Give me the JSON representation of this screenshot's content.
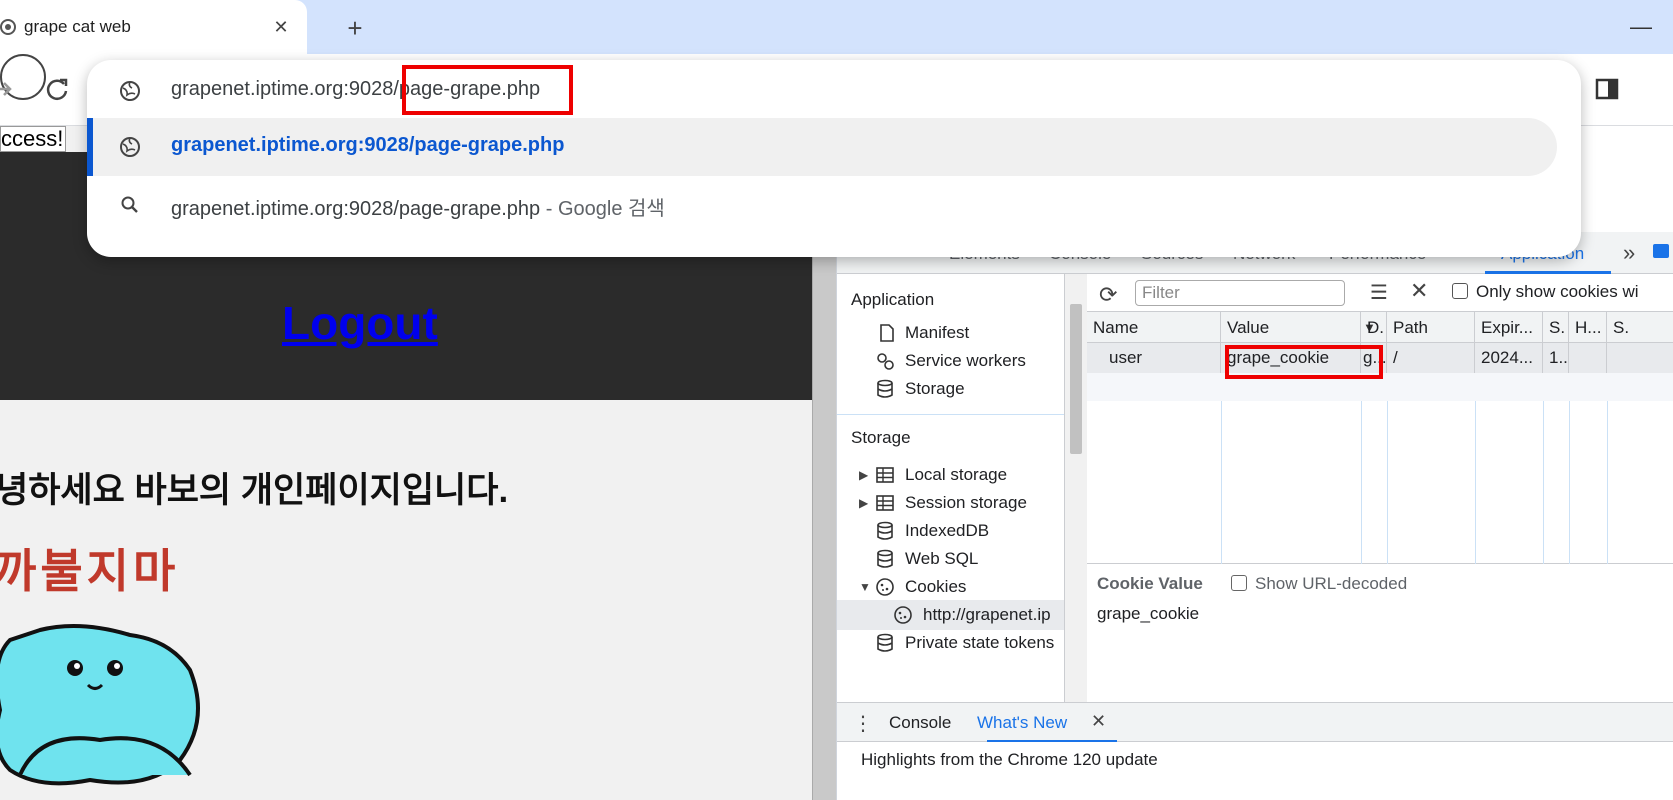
{
  "browser": {
    "tab_title": "grape cat web",
    "tab_close": "✕",
    "new_tab": "+",
    "minimize": "—"
  },
  "omnibox": {
    "input_host": "grapenet.iptime.org:9028",
    "input_path": "/page-grape.php",
    "suggestion_url": "grapenet.iptime.org:9028/page-grape.php",
    "search_query": "grapenet.iptime.org:9028/page-grape.php",
    "search_suffix": " - Google 검색"
  },
  "page": {
    "success_text": "ccess!",
    "logout_label": "Logout",
    "greeting": "녕하세요 바보의 개인페이지입니다.",
    "doodle_text": "까불지마"
  },
  "devtools": {
    "tabs": [
      {
        "label": "Elements"
      },
      {
        "label": "Console"
      },
      {
        "label": "Sources"
      },
      {
        "label": "Network"
      },
      {
        "label": "Performance"
      },
      {
        "label": "Application"
      }
    ],
    "more_tabs": "»",
    "sidebar": {
      "application_heading": "Application",
      "application_items": [
        {
          "label": "Manifest",
          "icon": "document-icon"
        },
        {
          "label": "Service workers",
          "icon": "gears-icon"
        },
        {
          "label": "Storage",
          "icon": "database-icon"
        }
      ],
      "storage_heading": "Storage",
      "storage_items": [
        {
          "label": "Local storage",
          "icon": "table-icon"
        },
        {
          "label": "Session storage",
          "icon": "table-icon"
        },
        {
          "label": "IndexedDB",
          "icon": "database-icon"
        },
        {
          "label": "Web SQL",
          "icon": "database-icon"
        },
        {
          "label": "Cookies",
          "icon": "cookie-icon"
        },
        {
          "label": "http://grapenet.ip",
          "icon": "cookie-icon"
        },
        {
          "label": "Private state tokens",
          "icon": "database-icon"
        }
      ]
    },
    "filter_placeholder": "Filter",
    "only_show_label": "Only show cookies wi",
    "cookie_table": {
      "columns": [
        "Name",
        "Value",
        "D.",
        "Path",
        "Expir...",
        "S.",
        "H...",
        "S."
      ],
      "rows": [
        {
          "name": "user",
          "value": "grape_cookie",
          "domain": "g...",
          "path": "/",
          "expires": "2024...",
          "size": "1..",
          "httponly": "",
          "secure": ""
        }
      ]
    },
    "cookie_value_title": "Cookie Value",
    "show_url_decoded": "Show URL-decoded",
    "cookie_value": "grape_cookie",
    "drawer": {
      "menu": "⋮",
      "tabs": [
        {
          "label": "Console"
        },
        {
          "label": "What's New"
        }
      ],
      "close": "✕",
      "content": "Highlights from the Chrome 120 update"
    }
  },
  "colors": {
    "accent": "#1a73e8",
    "highlight": "#ee0000",
    "tabstrip": "#d3e3fd",
    "page_header": "#2b2b2b"
  }
}
